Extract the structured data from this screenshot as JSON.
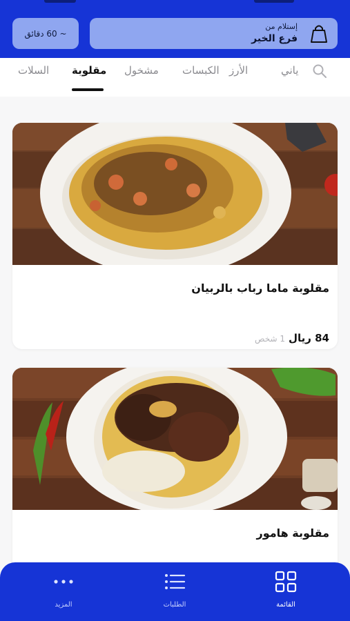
{
  "header": {
    "pickup_title": "إستلام من",
    "pickup_branch": "فرع الخير",
    "time_estimate": "~ 60 دقائق",
    "bag_icon": "shopping-bag-icon"
  },
  "tabs": {
    "items": [
      {
        "label": "ياني",
        "active": false
      },
      {
        "label": "الأرز",
        "active": false
      },
      {
        "label": "الكبسات",
        "active": false
      },
      {
        "label": "مشخول",
        "active": false
      },
      {
        "label": "مقلوبة",
        "active": true
      },
      {
        "label": "السلات",
        "active": false
      }
    ],
    "search_icon": "search-icon"
  },
  "products": [
    {
      "name": "مقلوبة ماما رباب بالربيان",
      "price": "84 ريال",
      "serves": "1 شخص"
    },
    {
      "name": "مقلوبة هامور",
      "price": "",
      "serves": ""
    }
  ],
  "bottom_nav": {
    "items": [
      {
        "label": "القائمة",
        "icon": "grid-icon",
        "active": true
      },
      {
        "label": "الطلبات",
        "icon": "list-icon",
        "active": false
      },
      {
        "label": "المزيد",
        "icon": "more-dots-icon",
        "active": false
      }
    ]
  },
  "colors": {
    "brand": "#1634d6",
    "chip": "#8fa6f0",
    "background": "#f7f7f8"
  }
}
